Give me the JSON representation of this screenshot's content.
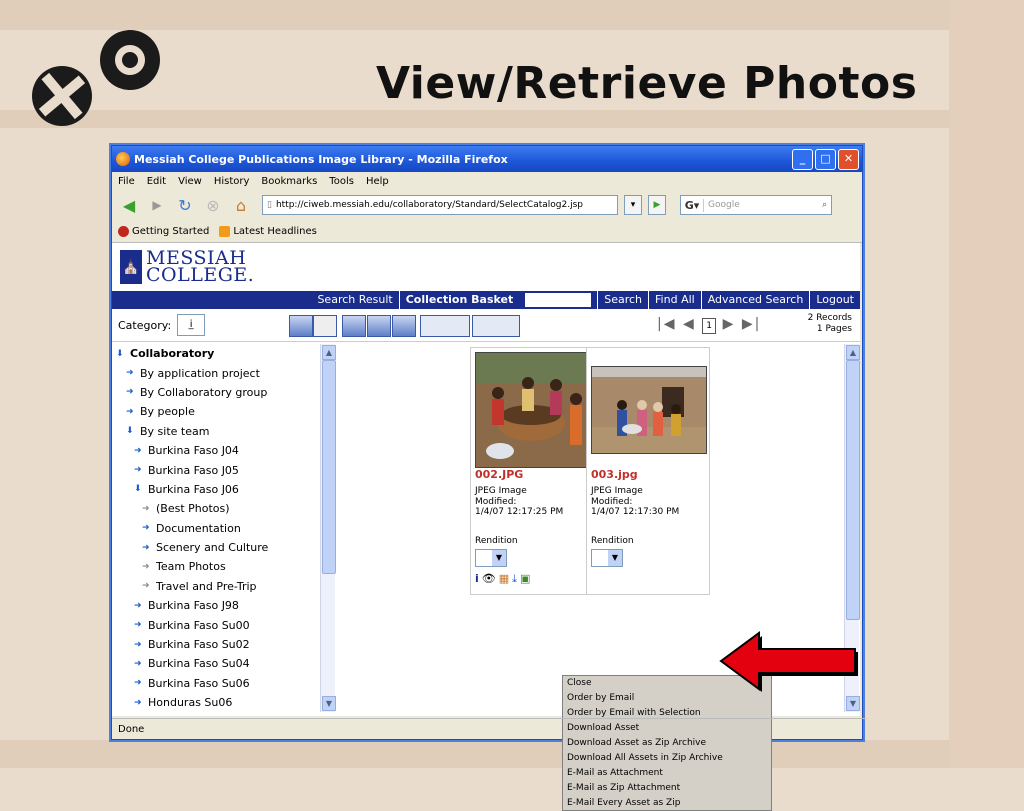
{
  "slide": {
    "title": "View/Retrieve Photos"
  },
  "window": {
    "title": "Messiah College Publications Image Library - Mozilla Firefox",
    "menu": [
      "File",
      "Edit",
      "View",
      "History",
      "Bookmarks",
      "Tools",
      "Help"
    ],
    "url": "http://ciweb.messiah.edu/collaboratory/Standard/SelectCatalog2.jsp",
    "search_placeholder": "Google",
    "bookmarks": [
      "Getting Started",
      "Latest Headlines"
    ],
    "status": "Done"
  },
  "site": {
    "logo_line1": "MESSIAH",
    "logo_line2": "COLLEGE.",
    "nav": [
      "Search Result",
      "Collection Basket",
      "Search",
      "Find All",
      "Advanced Search",
      "Logout"
    ],
    "category_label": "Category:",
    "records": "2  Records",
    "pages": "1  Pages",
    "page_number": "1"
  },
  "tree": [
    {
      "label": "Collaboratory",
      "indent": 0,
      "bold": true,
      "icon": "down-arrow"
    },
    {
      "label": "By application project",
      "indent": 1,
      "icon": "right-arrow"
    },
    {
      "label": "By Collaboratory group",
      "indent": 1,
      "icon": "right-arrow"
    },
    {
      "label": "By people",
      "indent": 1,
      "icon": "right-arrow"
    },
    {
      "label": "By site team",
      "indent": 1,
      "icon": "down-arrow"
    },
    {
      "label": "Burkina Faso J04",
      "indent": 2,
      "icon": "right-arrow"
    },
    {
      "label": "Burkina Faso J05",
      "indent": 2,
      "icon": "right-arrow"
    },
    {
      "label": "Burkina Faso J06",
      "indent": 2,
      "icon": "down-arrow"
    },
    {
      "label": "(Best Photos)",
      "indent": 3,
      "icon": "grey-arrow"
    },
    {
      "label": "Documentation",
      "indent": 3,
      "icon": "right-arrow"
    },
    {
      "label": "Scenery and Culture",
      "indent": 3,
      "icon": "right-arrow"
    },
    {
      "label": "Team Photos",
      "indent": 3,
      "icon": "grey-arrow"
    },
    {
      "label": "Travel and Pre-Trip",
      "indent": 3,
      "icon": "grey-arrow"
    },
    {
      "label": "Burkina Faso J98",
      "indent": 2,
      "icon": "right-arrow"
    },
    {
      "label": "Burkina Faso Su00",
      "indent": 2,
      "icon": "right-arrow"
    },
    {
      "label": "Burkina Faso Su02",
      "indent": 2,
      "icon": "right-arrow"
    },
    {
      "label": "Burkina Faso Su04",
      "indent": 2,
      "icon": "right-arrow"
    },
    {
      "label": "Burkina Faso Su06",
      "indent": 2,
      "icon": "right-arrow"
    },
    {
      "label": "Honduras Su06",
      "indent": 2,
      "icon": "right-arrow"
    }
  ],
  "assets": [
    {
      "filename": "002.JPG",
      "type": "JPEG Image",
      "modified_label": "Modified:",
      "modified": "1/4/07 12:17:25 PM",
      "rendition_label": "Rendition"
    },
    {
      "filename": "003.jpg",
      "type": "JPEG Image",
      "modified_label": "Modified:",
      "modified": "1/4/07 12:17:30 PM",
      "rendition_label": "Rendition"
    }
  ],
  "context_menu": [
    "Close",
    "Order by Email",
    "Order by Email with Selection",
    "Download Asset",
    "Download Asset as Zip Archive",
    "Download All Assets in Zip Archive",
    "E-Mail as Attachment",
    "E-Mail as Zip Attachment",
    "E-Mail Every Asset as Zip"
  ],
  "colors": {
    "accent_navy": "#1a2d8c",
    "filename_red": "#c0302a",
    "arrow_red": "#e3000f"
  }
}
